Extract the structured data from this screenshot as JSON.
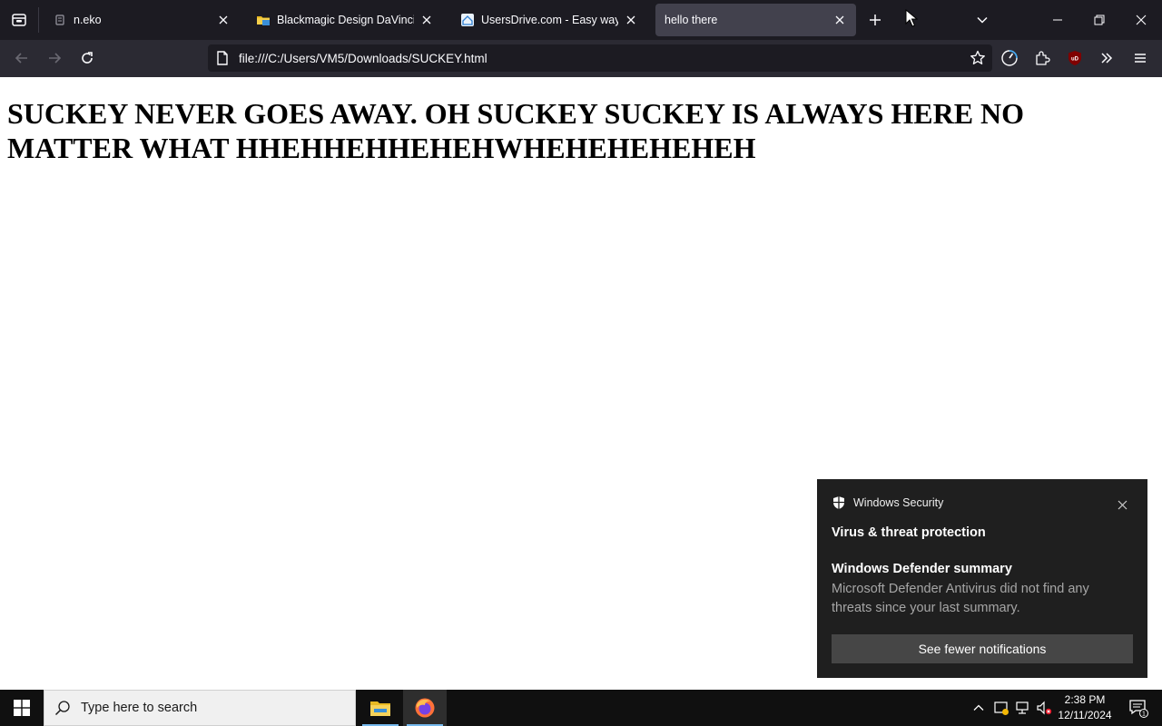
{
  "browser": {
    "tabs": [
      {
        "title": "n.eko",
        "icon": "neko-favicon",
        "active": false
      },
      {
        "title": "Blackmagic Design DaVinci Resolve",
        "icon": "folder-favicon",
        "active": false
      },
      {
        "title": "UsersDrive.com - Easy way to share",
        "icon": "usersdrive-favicon",
        "active": false
      },
      {
        "title": "hello there",
        "icon": "",
        "active": true
      }
    ],
    "url": "file:///C:/Users/VM5/Downloads/SUCKEY.html",
    "ublock_badge": "uD"
  },
  "page": {
    "heading": "SUCKEY NEVER GOES AWAY. OH SUCKEY SUCKEY IS ALWAYS HERE NO MATTER WHAT HHEHHEHHEHEHWHEHEHEHEHEH"
  },
  "toast": {
    "app_name": "Windows Security",
    "category": "Virus & threat protection",
    "title": "Windows Defender summary",
    "body": "Microsoft Defender Antivirus did not find any threats since your last summary.",
    "button": "See fewer notifications"
  },
  "taskbar": {
    "search_placeholder": "Type here to search",
    "time": "2:38 PM",
    "date": "12/11/2024",
    "notification_count": "1"
  },
  "colors": {
    "tab_strip": "#1c1b22",
    "nav_bar": "#2b2a33",
    "active_tab": "#42414d",
    "toast_bg": "#1f1f1f",
    "taskbar_bg": "#101010"
  }
}
